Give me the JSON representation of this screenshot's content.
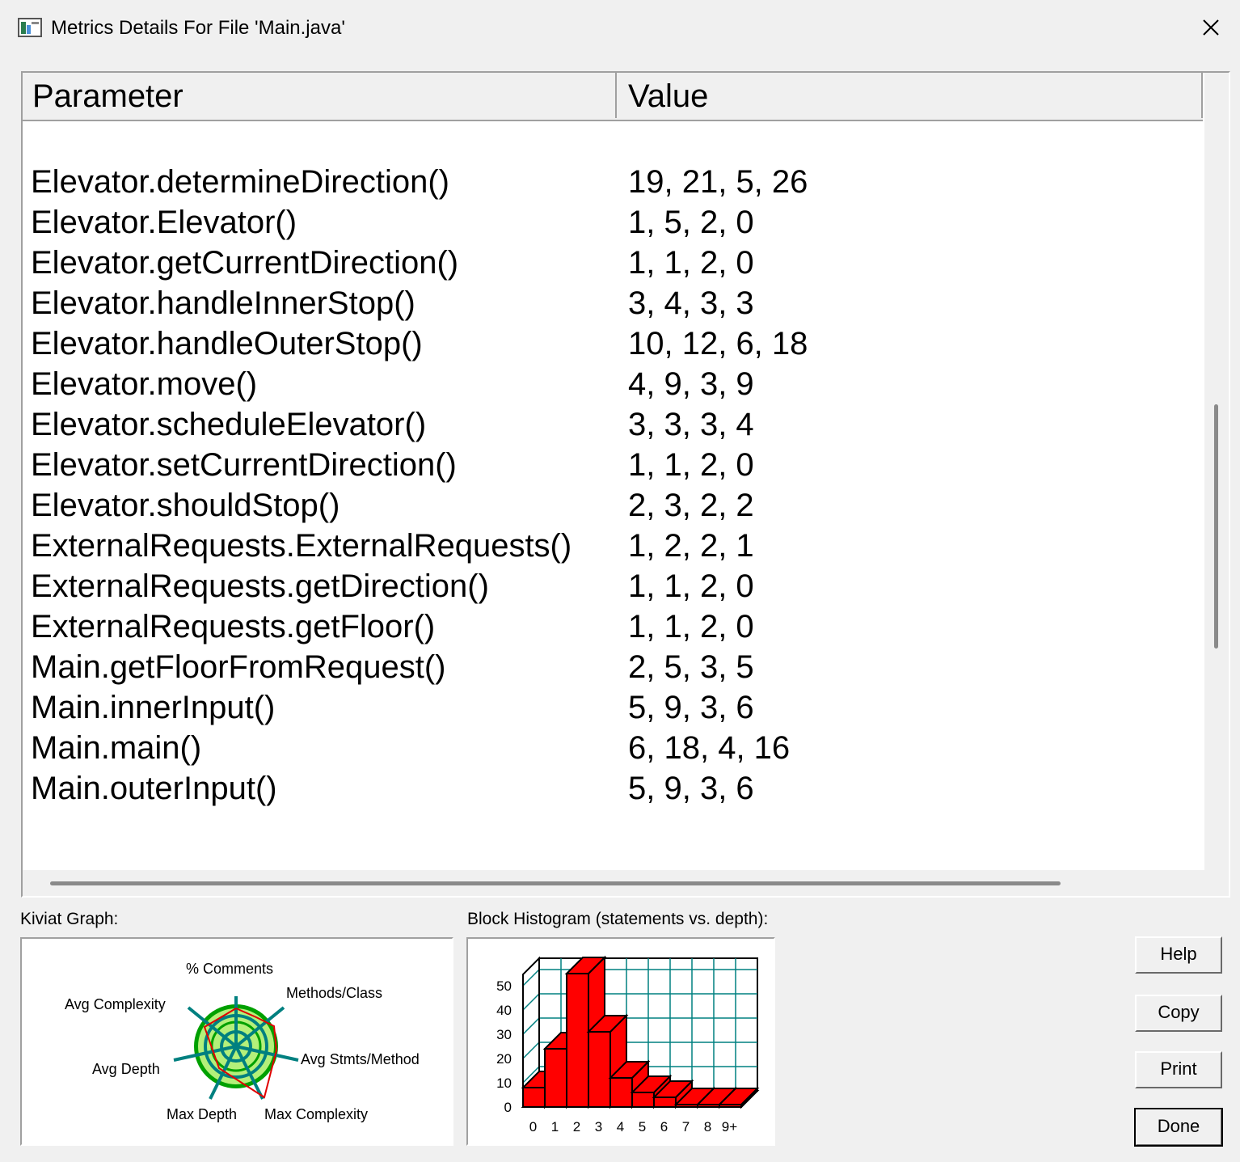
{
  "window": {
    "title": "Metrics Details For File 'Main.java'"
  },
  "table": {
    "columns": [
      "Parameter",
      "Value"
    ],
    "rows": [
      {
        "parameter": "Elevator.determineDirection()",
        "value": "19, 21, 5, 26"
      },
      {
        "parameter": "Elevator.Elevator()",
        "value": "1, 5, 2, 0"
      },
      {
        "parameter": "Elevator.getCurrentDirection()",
        "value": "1, 1, 2, 0"
      },
      {
        "parameter": "Elevator.handleInnerStop()",
        "value": "3, 4, 3, 3"
      },
      {
        "parameter": "Elevator.handleOuterStop()",
        "value": "10, 12, 6, 18"
      },
      {
        "parameter": "Elevator.move()",
        "value": "4, 9, 3, 9"
      },
      {
        "parameter": "Elevator.scheduleElevator()",
        "value": "3, 3, 3, 4"
      },
      {
        "parameter": "Elevator.setCurrentDirection()",
        "value": "1, 1, 2, 0"
      },
      {
        "parameter": "Elevator.shouldStop()",
        "value": "2, 3, 2, 2"
      },
      {
        "parameter": "ExternalRequests.ExternalRequests()",
        "value": "1, 2, 2, 1"
      },
      {
        "parameter": "ExternalRequests.getDirection()",
        "value": "1, 1, 2, 0"
      },
      {
        "parameter": "ExternalRequests.getFloor()",
        "value": "1, 1, 2, 0"
      },
      {
        "parameter": "Main.getFloorFromRequest()",
        "value": "2, 5, 3, 5"
      },
      {
        "parameter": "Main.innerInput()",
        "value": "5, 9, 3, 6"
      },
      {
        "parameter": "Main.main()",
        "value": "6, 18, 4, 16"
      },
      {
        "parameter": "Main.outerInput()",
        "value": "5, 9, 3, 6"
      }
    ]
  },
  "kiviat": {
    "label": "Kiviat Graph:",
    "axes": [
      "% Comments",
      "Methods/Class",
      "Avg Stmts/Method",
      "Max Complexity",
      "Max Depth",
      "Avg Depth",
      "Avg Complexity"
    ]
  },
  "histogram": {
    "label": "Block Histogram (statements vs. depth):"
  },
  "chart_data": {
    "type": "bar",
    "categories": [
      "0",
      "1",
      "2",
      "3",
      "4",
      "5",
      "6",
      "7",
      "8",
      "9+"
    ],
    "values": [
      8,
      24,
      55,
      31,
      12,
      6,
      4,
      1,
      1,
      1
    ],
    "ylim": [
      0,
      50
    ],
    "yticks": [
      "0",
      "10",
      "20",
      "30",
      "40",
      "50"
    ],
    "bar_color": "#ff0000",
    "grid_color": "#008080",
    "grid": true
  },
  "buttons": {
    "help": "Help",
    "copy": "Copy",
    "print": "Print",
    "done": "Done"
  }
}
